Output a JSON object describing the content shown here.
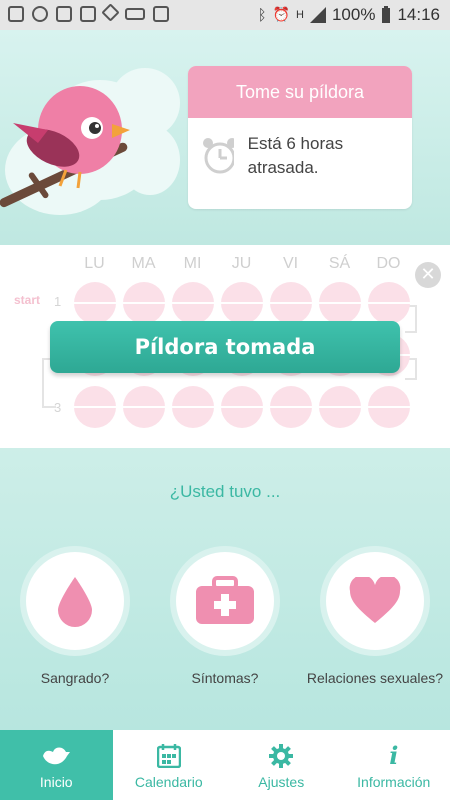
{
  "status_bar": {
    "battery": "100%",
    "time": "14:16",
    "network": "H"
  },
  "reminder": {
    "title": "Tome su píldora",
    "message": "Está 6 horas atrasada."
  },
  "pill_pack": {
    "start_label": "start",
    "days": [
      "LU",
      "MA",
      "MI",
      "JU",
      "VI",
      "SÁ",
      "DO"
    ],
    "week_numbers": [
      "1",
      "3"
    ],
    "taken_button": "Píldora tomada"
  },
  "question": {
    "title": "¿Usted tuvo ...",
    "options": [
      {
        "label": "Sangrado?",
        "icon": "drop-icon"
      },
      {
        "label": "Síntomas?",
        "icon": "first-aid-icon"
      },
      {
        "label": "Relaciones sexuales?",
        "icon": "heart-icon"
      }
    ]
  },
  "nav": {
    "items": [
      {
        "label": "Inicio",
        "icon": "bird-icon",
        "active": true
      },
      {
        "label": "Calendario",
        "icon": "calendar-icon",
        "active": false
      },
      {
        "label": "Ajustes",
        "icon": "gear-icon",
        "active": false
      },
      {
        "label": "Información",
        "icon": "info-icon",
        "active": false
      }
    ]
  },
  "colors": {
    "accent": "#40bfa9",
    "pink": "#f2a3be",
    "background": "#c9ece6"
  }
}
